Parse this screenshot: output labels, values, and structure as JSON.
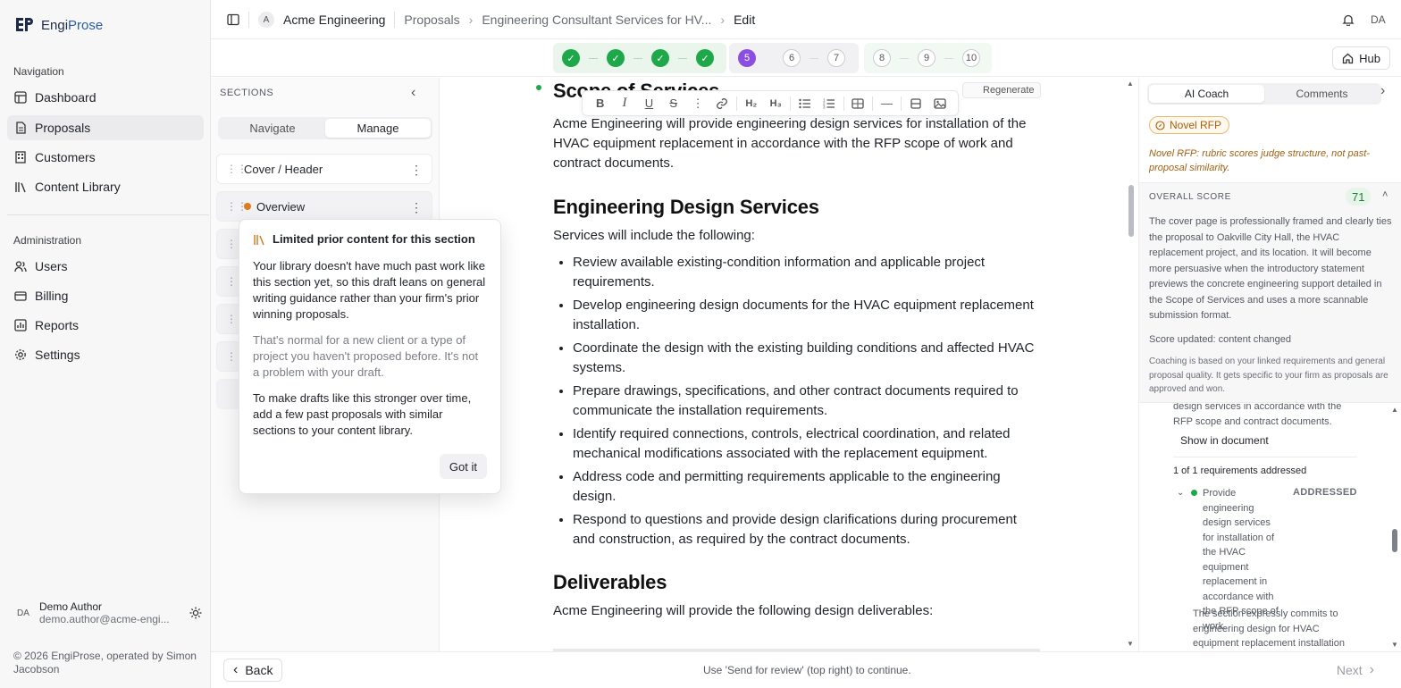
{
  "app": {
    "brand_prefix": "Engi",
    "brand_suffix": "Prose"
  },
  "sidebar": {
    "navigation_label": "Navigation",
    "nav_items": [
      {
        "label": "Dashboard",
        "icon": "dashboard-icon"
      },
      {
        "label": "Proposals",
        "icon": "document-icon",
        "active": true
      },
      {
        "label": "Customers",
        "icon": "building-icon"
      },
      {
        "label": "Content Library",
        "icon": "library-icon"
      }
    ],
    "administration_label": "Administration",
    "admin_items": [
      {
        "label": "Users",
        "icon": "users-icon"
      },
      {
        "label": "Billing",
        "icon": "card-icon"
      },
      {
        "label": "Reports",
        "icon": "chart-icon"
      },
      {
        "label": "Settings",
        "icon": "gear-icon"
      }
    ],
    "user": {
      "initials": "DA",
      "name": "Demo Author",
      "email": "demo.author@acme-engi..."
    },
    "footer": "© 2026 EngiProse, operated by Simon Jacobson"
  },
  "topbar": {
    "org_initial": "A",
    "org_name": "Acme Engineering",
    "crumbs": [
      "Proposals",
      "Engineering Consultant Services for HV...",
      "Edit"
    ],
    "user_initials": "DA"
  },
  "stepper": {
    "done_steps": 4,
    "current_step": "5",
    "group_b": [
      "6",
      "7"
    ],
    "group_c": [
      "8",
      "9",
      "10"
    ],
    "hub_label": "Hub"
  },
  "sections_panel": {
    "title": "SECTIONS",
    "tabs": [
      "Navigate",
      "Manage"
    ],
    "active_tab": "Manage",
    "items": [
      "Cover / Header",
      "Overview"
    ]
  },
  "popover": {
    "title": "Limited prior content for this section",
    "p1": "Your library doesn't have much past work like this section yet, so this draft leans on general writing guidance rather than your firm's prior winning proposals.",
    "p2": "That's normal for a new client or a type of project you haven't proposed before. It's not a problem with your draft.",
    "p3": "To make drafts like this stronger over time, add a few past proposals with similar sections to your content library.",
    "button": "Got it"
  },
  "editor": {
    "regenerate": "Regenerate",
    "heading_partial": "Scope of Services",
    "intro": "Acme Engineering will provide engineering design services for installation of the HVAC equipment replacement in accordance with the RFP scope of work and contract documents.",
    "h2": "Engineering Design Services",
    "services_intro": "Services will include the following:",
    "services": [
      "Review available existing-condition information and applicable project requirements.",
      "Develop engineering design documents for the HVAC equipment replacement installation.",
      "Coordinate the design with the existing building conditions and affected HVAC systems.",
      "Prepare drawings, specifications, and other contract documents required to communicate the installation requirements.",
      "Identify required connections, controls, electrical coordination, and related mechanical modifications associated with the replacement equipment.",
      "Address code and permitting requirements applicable to the engineering design.",
      "Respond to questions and provide design clarifications during procurement and construction, as required by the contract documents."
    ],
    "h3": "Deliverables",
    "deliverables_intro": "Acme Engineering will provide the following design deliverables:"
  },
  "coach": {
    "tabs": [
      "AI Coach",
      "Comments"
    ],
    "active_tab": "AI Coach",
    "novel_pill": "Novel RFP",
    "novel_note": "Novel RFP: rubric scores judge structure, not past-proposal similarity.",
    "score_label": "OVERALL SCORE",
    "score": "71",
    "score_text": "The cover page is professionally framed and clearly ties the proposal to Oakville City Hall, the HVAC replacement project, and its location. It will become more persuasive when the introductory statement previews the concrete engineering support detailed in the Scope of Services and uses a more scannable submission format.",
    "score_updated": "Score updated: content changed",
    "coaching_note": "Coaching is based on your linked requirements and general proposal quality. It gets specific to your firm as proposals are approved and won.",
    "req_snippet": "design services in accordance with the RFP scope and contract documents.",
    "show_in_document": "Show in document",
    "req_count": "1 of 1 requirements addressed",
    "req_item": "Provide engineering design services for installation of the HVAC equipment replacement in accordance with the RFP scope of work.",
    "req_status": "ADDRESSED",
    "req_explanation": "The section expressly commits to engineering design for HVAC equipment replacement installation"
  },
  "bottombar": {
    "back": "Back",
    "hint": "Use 'Send for review' (top right) to continue.",
    "next": "Next"
  },
  "colors": {
    "done_green": "#1ea84a",
    "current_purple": "#8a4fe0",
    "warning_orange": "#e07a1a",
    "novel_text": "#a5600f",
    "brand_blue": "#2a5ca8"
  }
}
